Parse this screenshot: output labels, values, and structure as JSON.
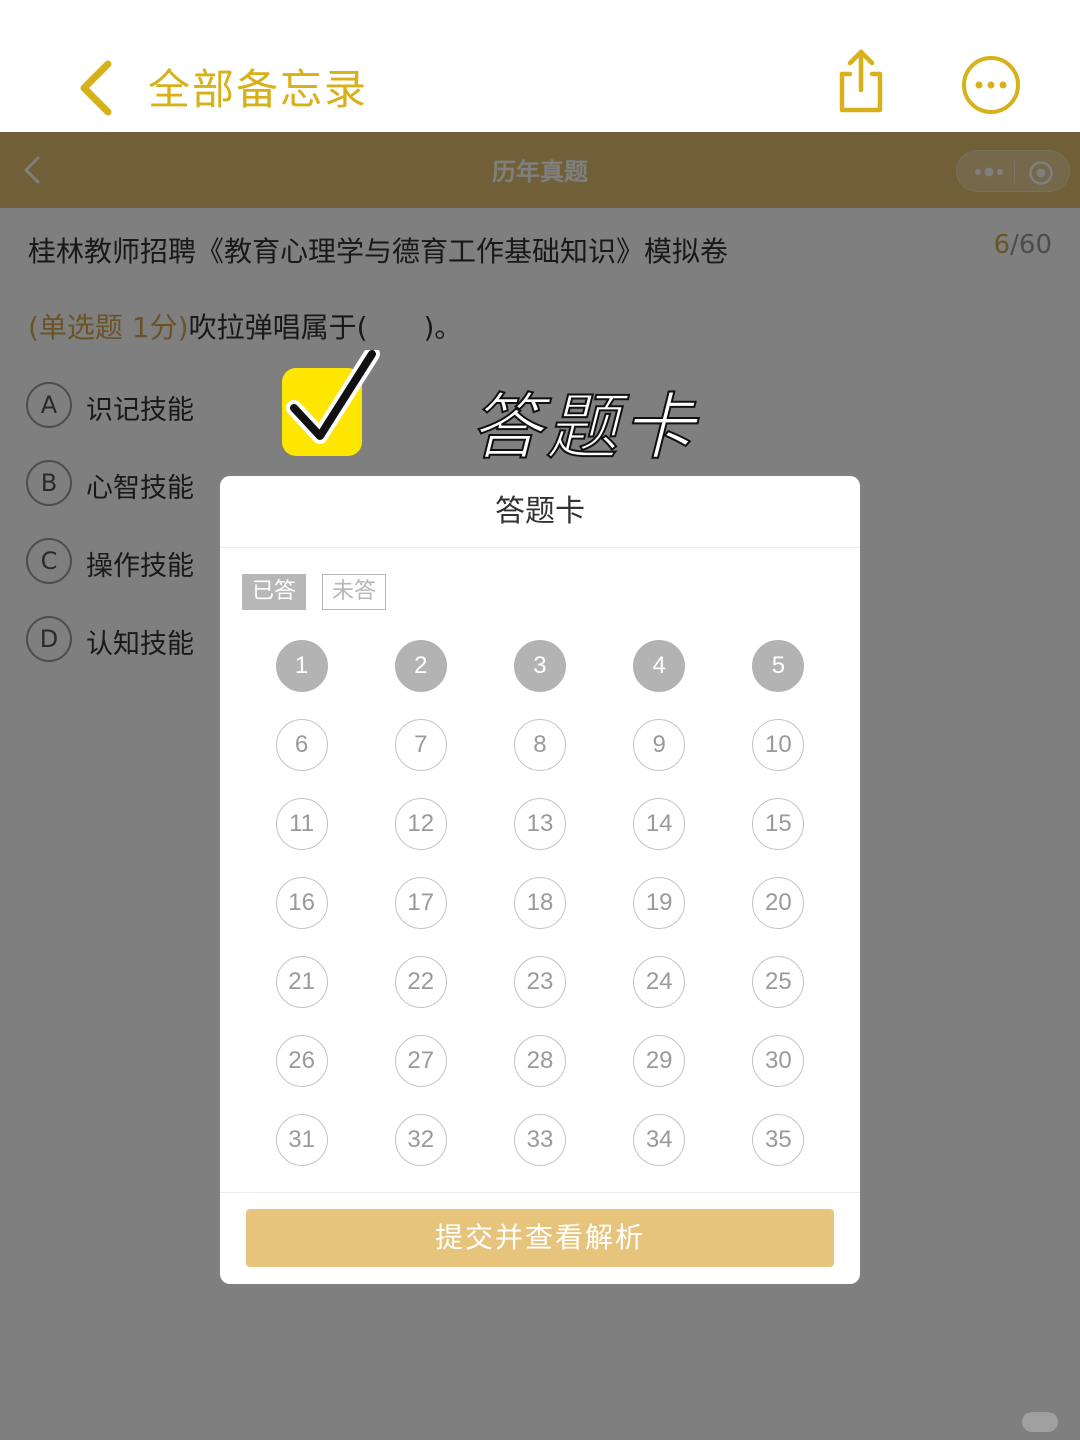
{
  "notes_header": {
    "title": "全部备忘录"
  },
  "mp_nav": {
    "title": "历年真题"
  },
  "quiz": {
    "exam_title": "桂林教师招聘《教育心理学与德育工作基础知识》模拟卷",
    "progress_current": "6",
    "progress_total": "/60",
    "question_type": "(单选题 1分)",
    "question_text": "吹拉弹唱属于(　　)。",
    "options": [
      {
        "letter": "A",
        "text": "识记技能"
      },
      {
        "letter": "B",
        "text": "心智技能"
      },
      {
        "letter": "C",
        "text": "操作技能"
      },
      {
        "letter": "D",
        "text": "认知技能"
      }
    ]
  },
  "sticker": {
    "text": "答题卡"
  },
  "answer_card": {
    "title": "答题卡",
    "legend_answered": "已答",
    "legend_unanswered": "未答",
    "numbers": [
      "1",
      "2",
      "3",
      "4",
      "5",
      "6",
      "7",
      "8",
      "9",
      "10",
      "11",
      "12",
      "13",
      "14",
      "15",
      "16",
      "17",
      "18",
      "19",
      "20",
      "21",
      "22",
      "23",
      "24",
      "25",
      "26",
      "27",
      "28",
      "29",
      "30",
      "31",
      "32",
      "33",
      "34",
      "35"
    ],
    "answered_count": 5,
    "submit_label": "提交并查看解析"
  },
  "colors": {
    "notes_accent": "#d8b01a",
    "mp_nav_bg": "#e2bf6f",
    "submit_bg": "#e6c47c",
    "answered_bg": "#b3b3b3"
  }
}
